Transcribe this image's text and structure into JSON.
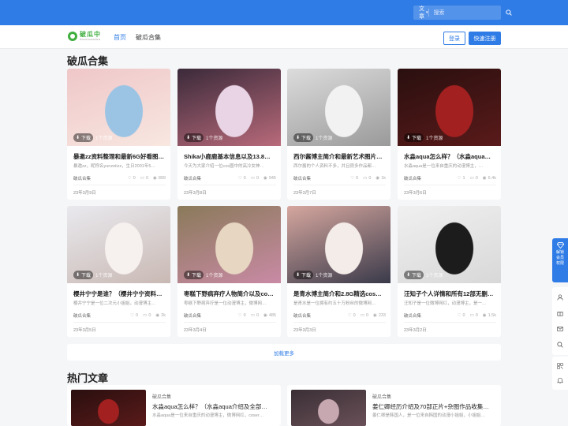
{
  "topbar": {
    "search_type": "文章",
    "search_placeholder": "搜索"
  },
  "header": {
    "logo_text": "破瓜中",
    "logo_sub": "POGUAZHONG",
    "nav": [
      {
        "label": "首页"
      },
      {
        "label": "破瓜合集"
      }
    ],
    "login_label": "登录",
    "register_label": "快速注册"
  },
  "main": {
    "section_title": "破瓜合集",
    "download_label": "下载",
    "cards": [
      {
        "title": "暴邀zz资料整理和最新6G好看图…",
        "desc": "暴邀zz，昵称名yunzeiizz，生日2001年5…",
        "category": "破瓜合集",
        "likes": "0",
        "comments": "0",
        "views": "899",
        "date": "23年3月9日",
        "resources": "1个资源",
        "palette": [
          "#efc7c9",
          "#9bc4e4",
          "#f8e7e0"
        ]
      },
      {
        "title": "Shika小鹿鹿基本信息以及13.8…",
        "desc": "今天为大家介绍一位cos圈中的高冷女神…",
        "category": "破瓜合集",
        "likes": "0",
        "comments": "0",
        "views": "945",
        "date": "23年3月8日",
        "resources": "1个资源",
        "palette": [
          "#3b2a3a",
          "#e8d4e4",
          "#b86a7a"
        ]
      },
      {
        "title": "西尔酱博主简介和最新艺术图片…",
        "desc": "西尔酱的个人资料不多，并且很多作品都…",
        "category": "破瓜合集",
        "likes": "0",
        "comments": "0",
        "views": "1k",
        "date": "23年3月7日",
        "resources": "1个资源",
        "palette": [
          "#dcdcdc",
          "#f2f2f2",
          "#9a9a9a"
        ]
      },
      {
        "title": "水淼aqua怎么样？（水淼aqua…",
        "desc": "水淼aqua是一位来自重庆的动漫博主，…",
        "category": "破瓜合集",
        "likes": "1",
        "comments": "0",
        "views": "6.4k",
        "date": "23年3月6日",
        "resources": "1个资源",
        "palette": [
          "#2a0f0f",
          "#a32020",
          "#5a1a1a"
        ]
      },
      {
        "title": "樱井宁宁是谁？（樱井宁宁资料…",
        "desc": "樱井宁宁是一位二次元小姐姐，动漫博主…",
        "category": "破瓜合集",
        "likes": "0",
        "comments": "0",
        "views": "2k",
        "date": "23年3月5日",
        "resources": "1个资源",
        "palette": [
          "#e9e9ee",
          "#f6f0ee",
          "#c9b9b4"
        ]
      },
      {
        "title": "枣糕下野病弃疗人物简介以及co…",
        "desc": "枣糕下野病弃疗是一位动漫博主，微博网…",
        "category": "破瓜合集",
        "likes": "0",
        "comments": "0",
        "views": "485",
        "date": "23年3月4日",
        "resources": "1个资源",
        "palette": [
          "#8a7a5a",
          "#e7d6c2",
          "#c98aa5"
        ]
      },
      {
        "title": "是青水博主简介和2.8G精选cos…",
        "desc": "是青水是一位拥有约五十万粉丝的微博网…",
        "category": "破瓜合集",
        "likes": "0",
        "comments": "0",
        "views": "233",
        "date": "23年3月3日",
        "resources": "1个资源",
        "palette": [
          "#d6a79f",
          "#f4ece8",
          "#3a3a4a"
        ]
      },
      {
        "title": "汪知子个人详情和所有12部无删…",
        "desc": "汪知子是一位微博网红，动漫博主，是一…",
        "category": "破瓜合集",
        "likes": "0",
        "comments": "0",
        "views": "1.5k",
        "date": "23年3月2日",
        "resources": "1个资源",
        "palette": [
          "#f0f0f0",
          "#1c1c1c",
          "#d8d8d8"
        ]
      }
    ],
    "load_more": "加载更多"
  },
  "hot": {
    "section_title": "热门文章",
    "items": [
      {
        "category": "破瓜合集",
        "title": "水淼aqua怎么样？（水淼aqua介绍及全部…",
        "desc": "水淼aqua是一位来自重庆的动漫博主，微博网红，coser…",
        "palette": [
          "#2a0f0f",
          "#a32020",
          "#5a1a1a"
        ]
      },
      {
        "category": "破瓜合集",
        "title": "姜仁卿经历介绍及70部正片+杂图作品收集…",
        "desc": "姜仁卿是韩国人，是一位来自韩国的动漫小姐姐，小姐姐…",
        "palette": [
          "#3a2f35",
          "#c8a8b0",
          "#6a5058"
        ]
      }
    ]
  },
  "sidebar": {
    "vip_label": "解锁会员权限",
    "tools": [
      "user-icon",
      "gift-icon",
      "mail-icon",
      "search-icon",
      "qrcode-icon",
      "bell-icon"
    ]
  },
  "colors": {
    "brand": "#2f7ce6",
    "logo_green": "#3fae3f"
  }
}
